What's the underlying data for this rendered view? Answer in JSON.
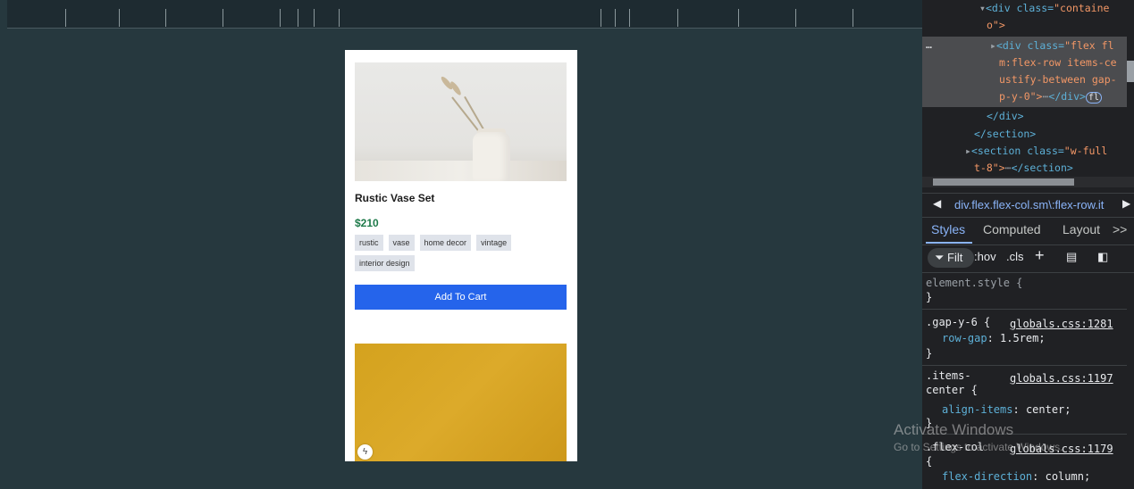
{
  "preview": {
    "product_name": "Rustic Vase Set",
    "price": "$210",
    "tags": [
      "rustic",
      "vase",
      "home decor",
      "vintage",
      "interior design"
    ],
    "cart_button": "Add To Cart",
    "bolt_icon": "bolt-icon"
  },
  "devtools": {
    "dom_tree": {
      "line1_tag": "<div class=",
      "line1_val": "\"containe",
      "line2_val": "o\">",
      "ellipsis": "…",
      "line3_tag": "<div class=",
      "line3_val": "\"flex fl",
      "line4_val": "m:flex-row items-ce",
      "line5_val": "ustify-between gap-",
      "line6_val": "p-y-0\">",
      "line6_close": "</div>",
      "line6_badge": "fl",
      "line7": "</div>",
      "line8": "</section>",
      "line9_tag": "<section class=",
      "line9_val": "\"w-full",
      "line10_val": "t-8\">",
      "line10_close": "</section>"
    },
    "breadcrumb": "div.flex.flex-col.sm\\:flex-row.it",
    "tabs": [
      "Styles",
      "Computed",
      "Layout",
      ">>"
    ],
    "toolbar": {
      "filter": "Filt",
      "hov": ":hov",
      "cls": ".cls",
      "add": "+",
      "paint_icon": "paint-icon",
      "toggle_icon": "sidebar-toggle-icon"
    },
    "styles": {
      "element_style": "element.style {",
      "close": "}",
      "rule1_selector": ".gap-y-6 {",
      "rule1_source": "globals.css:1281",
      "rule1_prop": "row-gap",
      "rule1_value": "1.5rem;",
      "rule2_selector_a": ".items-",
      "rule2_selector_b": "center {",
      "rule2_source": "globals.css:1197",
      "rule2_prop": "align-items",
      "rule2_value": "center;",
      "rule3_selector": ".flex-col",
      "rule3_source": "globals.css:1179",
      "rule3_open": "{",
      "rule3_prop": "flex-direction",
      "rule3_value": "column;"
    }
  },
  "watermark": {
    "title": "Activate Windows",
    "subtitle": "Go to Settings to activate Windows."
  }
}
